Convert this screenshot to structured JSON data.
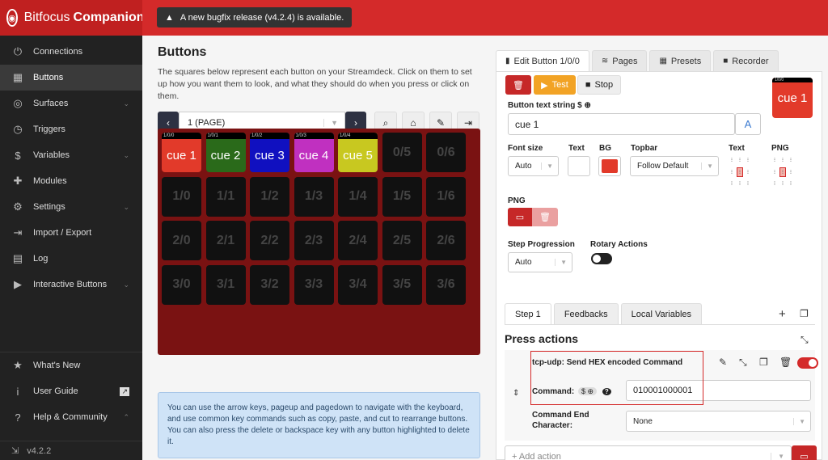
{
  "app": {
    "name_a": "Bitfocus",
    "name_b": "Companion",
    "version": "v4.2.2"
  },
  "toast": "A new bugfix release (v4.2.4) is available.",
  "sidebar": {
    "items": [
      {
        "label": "Connections",
        "icon": "plug-icon"
      },
      {
        "label": "Buttons",
        "icon": "grid-icon"
      },
      {
        "label": "Surfaces",
        "icon": "gamepad-icon"
      },
      {
        "label": "Triggers",
        "icon": "clock-icon"
      },
      {
        "label": "Variables",
        "icon": "dollar-icon"
      },
      {
        "label": "Modules",
        "icon": "puzzle-icon"
      },
      {
        "label": "Settings",
        "icon": "gear-icon"
      },
      {
        "label": "Import / Export",
        "icon": "file-import-icon"
      },
      {
        "label": "Log",
        "icon": "clipboard-icon"
      },
      {
        "label": "Interactive Buttons",
        "icon": "play-icon"
      }
    ],
    "bottom": [
      {
        "label": "What's New",
        "icon": "star-icon"
      },
      {
        "label": "User Guide",
        "icon": "info-icon"
      },
      {
        "label": "Help & Community",
        "icon": "question-icon"
      }
    ]
  },
  "buttons": {
    "title": "Buttons",
    "desc": "The squares below represent each button on your Streamdeck. Click on them to set up how you want them to look, and what they should do when you press or click on them.",
    "page": "1 (PAGE)",
    "info": "You can use the arrow keys, pageup and pagedown to navigate with the keyboard, and use common key commands such as copy, paste, and cut to rearrange buttons. You can also press the delete or backspace key with any button highlighted to delete it."
  },
  "grid": {
    "rows": [
      [
        "cue 1",
        "cue 2",
        "cue 3",
        "cue 4",
        "cue 5",
        "0/5",
        "0/6"
      ],
      [
        "1/0",
        "1/1",
        "1/2",
        "1/3",
        "1/4",
        "1/5",
        "1/6"
      ],
      [
        "2/0",
        "2/1",
        "2/2",
        "2/3",
        "2/4",
        "2/5",
        "2/6"
      ],
      [
        "3/0",
        "3/1",
        "3/2",
        "3/3",
        "3/4",
        "3/5",
        "3/6"
      ]
    ],
    "tags": [
      "1/0/0",
      "1/0/1",
      "1/0/2",
      "1/0/3",
      "1/0/4"
    ],
    "colors": [
      "#e23a2a",
      "#2a6a1a",
      "#1010c0",
      "#c030c0",
      "#c8c820"
    ]
  },
  "editor": {
    "tabs": [
      "Edit Button 1/0/0",
      "Pages",
      "Presets",
      "Recorder"
    ],
    "test": "Test",
    "stop": "Stop",
    "text_label": "Button text string",
    "text_value": "cue 1",
    "preview_text": "cue 1",
    "preview_tag": "1/0/0",
    "font_size_label": "Font size",
    "font_size": "Auto",
    "text_col_label": "Text",
    "bg_label": "BG",
    "bg_color": "#e23a2a",
    "topbar_label": "Topbar",
    "topbar": "Follow Default",
    "text_align_label": "Text",
    "png_align_label": "PNG",
    "png_label": "PNG",
    "step_label": "Step Progression",
    "step_value": "Auto",
    "rotary_label": "Rotary Actions",
    "step_tabs": [
      "Step 1",
      "Feedbacks",
      "Local Variables"
    ],
    "press_actions": "Press actions",
    "action_name": "tcp-udp: Send HEX encoded Command",
    "command_label": "Command:",
    "command_value": "010001000001",
    "end_char_label_1": "Command End",
    "end_char_label_2": "Character:",
    "end_char_value": "None",
    "add_action": "+ Add action"
  }
}
